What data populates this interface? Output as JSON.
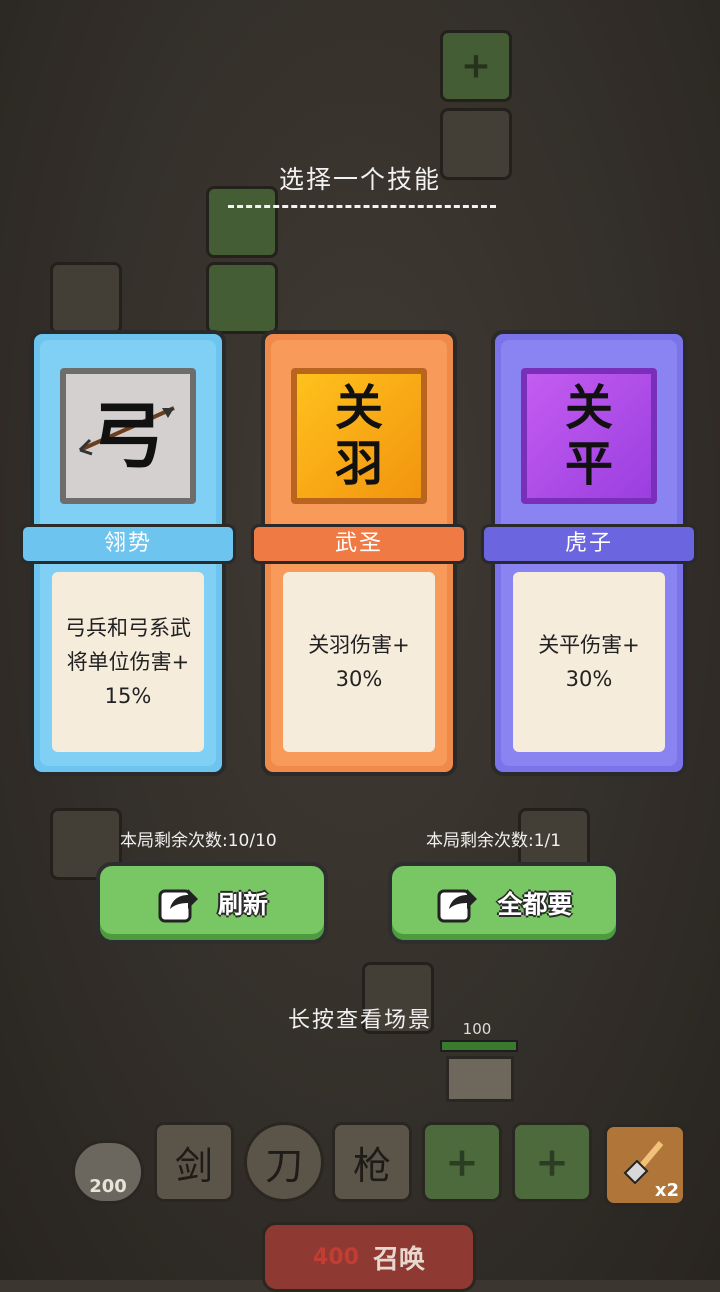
{
  "dialog": {
    "title": "选择一个技能"
  },
  "cards": [
    {
      "glyph": "弓",
      "name": "翎势",
      "description": "弓兵和弓系武\n将单位伤害+\n15%"
    },
    {
      "glyph": "关\n羽",
      "name": "武圣",
      "description": "关羽伤害+\n30%"
    },
    {
      "glyph": "关\n平",
      "name": "虎子",
      "description": "关平伤害+\n30%"
    }
  ],
  "refresh": {
    "counter": "本局剩余次数:10/10",
    "label": "刷新"
  },
  "take_all": {
    "counter": "本局剩余次数:1/1",
    "label": "全都要"
  },
  "hint": "长按查看场景",
  "bottom_bar": {
    "currency": "200",
    "slots": [
      "剑",
      "刀",
      "枪",
      "+",
      "+"
    ],
    "shovel_multiplier": "x2",
    "summon_cost": "400",
    "summon_label": "召唤",
    "base_hp": "100"
  }
}
